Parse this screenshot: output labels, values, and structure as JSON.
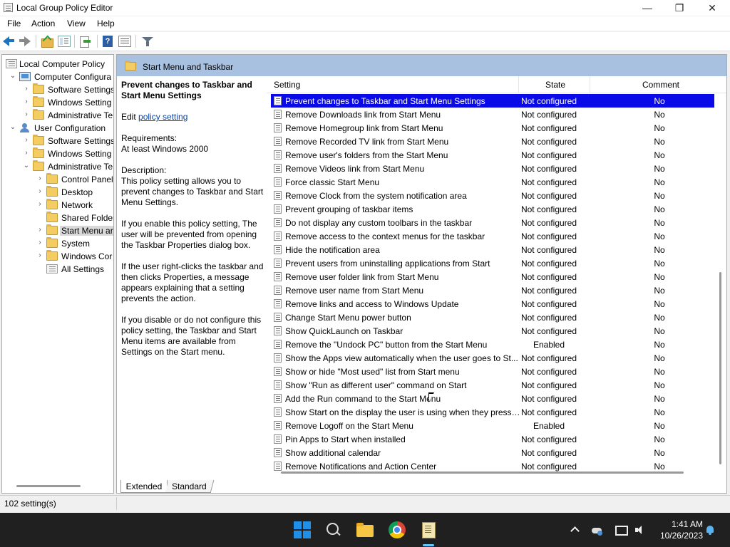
{
  "window": {
    "title": "Local Group Policy Editor",
    "minimize": "—",
    "maximize": "❐",
    "close": "✕"
  },
  "menu": [
    "File",
    "Action",
    "View",
    "Help"
  ],
  "tree": [
    {
      "label": "Local Computer Policy",
      "chev": "",
      "icon": "policy-icon"
    },
    {
      "label": "Computer Configura",
      "chev": "⌄",
      "icon": "computer-icon"
    },
    {
      "label": "Software Settings",
      "chev": "›",
      "icon": "folder-icon"
    },
    {
      "label": "Windows Setting",
      "chev": "›",
      "icon": "folder-icon"
    },
    {
      "label": "Administrative Te",
      "chev": "›",
      "icon": "folder-icon"
    },
    {
      "label": "User Configuration",
      "chev": "⌄",
      "icon": "user-icon"
    },
    {
      "label": "Software Settings",
      "chev": "›",
      "icon": "folder-icon"
    },
    {
      "label": "Windows Setting",
      "chev": "›",
      "icon": "folder-icon"
    },
    {
      "label": "Administrative Te",
      "chev": "⌄",
      "icon": "folder-icon"
    },
    {
      "label": "Control Panel",
      "chev": "›",
      "icon": "folder-icon"
    },
    {
      "label": "Desktop",
      "chev": "›",
      "icon": "folder-icon"
    },
    {
      "label": "Network",
      "chev": "›",
      "icon": "folder-icon"
    },
    {
      "label": "Shared Folder",
      "chev": "",
      "icon": "folder-icon"
    },
    {
      "label": "Start Menu ar",
      "chev": "›",
      "icon": "folder-icon",
      "selected": true
    },
    {
      "label": "System",
      "chev": "›",
      "icon": "folder-icon"
    },
    {
      "label": "Windows Cor",
      "chev": "›",
      "icon": "folder-icon"
    },
    {
      "label": "All Settings",
      "chev": "",
      "icon": "policy-icon"
    }
  ],
  "header": {
    "title": "Start Menu and Taskbar"
  },
  "description": {
    "title": "Prevent changes to Taskbar and Start Menu Settings",
    "edit_prefix": "Edit ",
    "edit_link": "policy setting ",
    "requirements_label": "Requirements:",
    "requirements": "At least Windows 2000",
    "description_label": "Description:",
    "para1": "This policy setting allows you to prevent changes to Taskbar and Start Menu Settings.",
    "para2": "If you enable this policy setting, The user will be prevented from opening the Taskbar Properties dialog box.",
    "para3": "If the user right-clicks the taskbar and then clicks Properties, a message appears explaining that a setting prevents the action.",
    "para4": "If you disable or do not configure this policy setting, the Taskbar and Start Menu items are available from Settings on the Start menu."
  },
  "columns": {
    "setting": "Setting",
    "state": "State",
    "comment": "Comment"
  },
  "settings": [
    {
      "name": "Prevent changes to Taskbar and Start Menu Settings",
      "state": "Not configured",
      "comment": "No",
      "selected": true
    },
    {
      "name": "Remove Downloads link from Start Menu",
      "state": "Not configured",
      "comment": "No"
    },
    {
      "name": "Remove Homegroup link from Start Menu",
      "state": "Not configured",
      "comment": "No"
    },
    {
      "name": "Remove Recorded TV link from Start Menu",
      "state": "Not configured",
      "comment": "No"
    },
    {
      "name": "Remove user's folders from the Start Menu",
      "state": "Not configured",
      "comment": "No"
    },
    {
      "name": "Remove Videos link from Start Menu",
      "state": "Not configured",
      "comment": "No"
    },
    {
      "name": "Force classic Start Menu",
      "state": "Not configured",
      "comment": "No"
    },
    {
      "name": "Remove Clock from the system notification area",
      "state": "Not configured",
      "comment": "No"
    },
    {
      "name": "Prevent grouping of taskbar items",
      "state": "Not configured",
      "comment": "No"
    },
    {
      "name": "Do not display any custom toolbars in the taskbar",
      "state": "Not configured",
      "comment": "No"
    },
    {
      "name": "Remove access to the context menus for the taskbar",
      "state": "Not configured",
      "comment": "No"
    },
    {
      "name": "Hide the notification area",
      "state": "Not configured",
      "comment": "No"
    },
    {
      "name": "Prevent users from uninstalling applications from Start",
      "state": "Not configured",
      "comment": "No"
    },
    {
      "name": "Remove user folder link from Start Menu",
      "state": "Not configured",
      "comment": "No"
    },
    {
      "name": "Remove user name from Start Menu",
      "state": "Not configured",
      "comment": "No"
    },
    {
      "name": "Remove links and access to Windows Update",
      "state": "Not configured",
      "comment": "No"
    },
    {
      "name": "Change Start Menu power button",
      "state": "Not configured",
      "comment": "No"
    },
    {
      "name": "Show QuickLaunch on Taskbar",
      "state": "Not configured",
      "comment": "No"
    },
    {
      "name": "Remove the \"Undock PC\" button from the Start Menu",
      "state": "Enabled",
      "comment": "No"
    },
    {
      "name": "Show the Apps view automatically when the user goes to St...",
      "state": "Not configured",
      "comment": "No"
    },
    {
      "name": "Show or hide \"Most used\" list from Start menu",
      "state": "Not configured",
      "comment": "No"
    },
    {
      "name": "Show \"Run as different user\" command on Start",
      "state": "Not configured",
      "comment": "No"
    },
    {
      "name": "Add the Run command to the Start Menu",
      "state": "Not configured",
      "comment": "No"
    },
    {
      "name": "Show Start on the display the user is using when they press t...",
      "state": "Not configured",
      "comment": "No"
    },
    {
      "name": "Remove Logoff on the Start Menu",
      "state": "Enabled",
      "comment": "No"
    },
    {
      "name": "Pin Apps to Start when installed",
      "state": "Not configured",
      "comment": "No"
    },
    {
      "name": "Show additional calendar",
      "state": "Not configured",
      "comment": "No"
    },
    {
      "name": "Remove Notifications and Action Center",
      "state": "Not configured",
      "comment": "No"
    }
  ],
  "tabs": {
    "extended": "Extended",
    "standard": "Standard"
  },
  "status": {
    "text": "102 setting(s)"
  },
  "taskbar": {
    "time": "1:41 AM",
    "date": "10/26/2023"
  },
  "colors": {
    "selection": "#0a0ae8",
    "header_band": "#a9c1e0",
    "taskbar": "#202020",
    "link": "#0645ad"
  }
}
